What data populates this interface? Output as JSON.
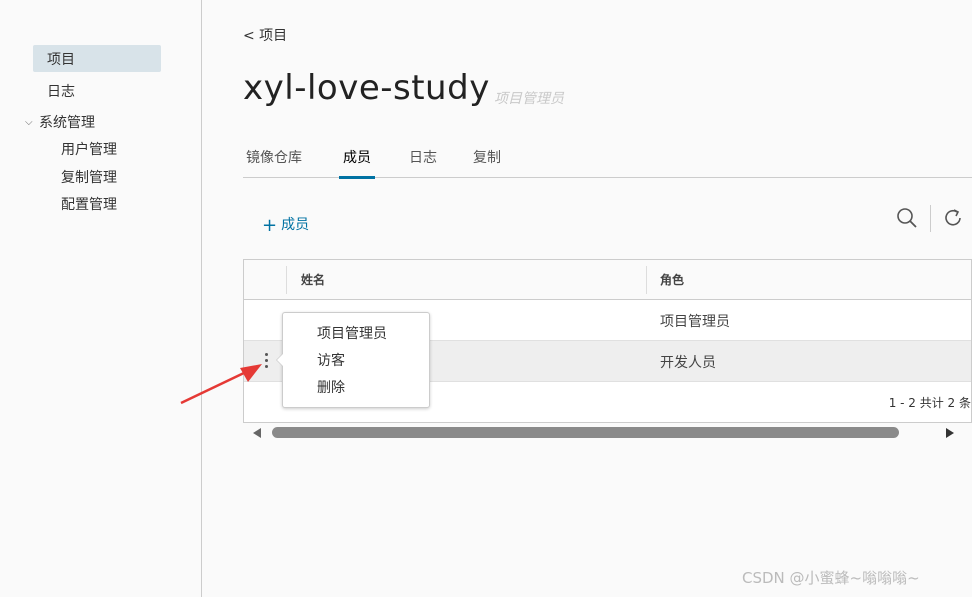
{
  "sidebar": {
    "items": [
      {
        "label": "项目"
      },
      {
        "label": "日志"
      },
      {
        "label": "系统管理"
      }
    ],
    "sub_items": [
      {
        "label": "用户管理"
      },
      {
        "label": "复制管理"
      },
      {
        "label": "配置管理"
      }
    ]
  },
  "header": {
    "back_label": "< 项目",
    "title": "xyl-love-study",
    "role": "项目管理员"
  },
  "tabs": [
    {
      "label": "镜像仓库"
    },
    {
      "label": "成员"
    },
    {
      "label": "日志"
    },
    {
      "label": "复制"
    }
  ],
  "toolbar": {
    "add_label": "成员",
    "search_icon": "search-icon",
    "refresh_icon": "refresh-icon"
  },
  "table": {
    "headers": [
      "姓名",
      "角色"
    ],
    "rows": [
      {
        "name": "",
        "role": "项目管理员"
      },
      {
        "name": "",
        "role": "开发人员"
      }
    ],
    "footer": "1 - 2 共计 2 条"
  },
  "popup_menu": {
    "items": [
      "项目管理员",
      "访客",
      "删除"
    ]
  },
  "watermark": "CSDN @小蜜蜂~嗡嗡嗡~",
  "colors": {
    "accent": "#0072a3",
    "annotation_arrow": "#e53935"
  }
}
